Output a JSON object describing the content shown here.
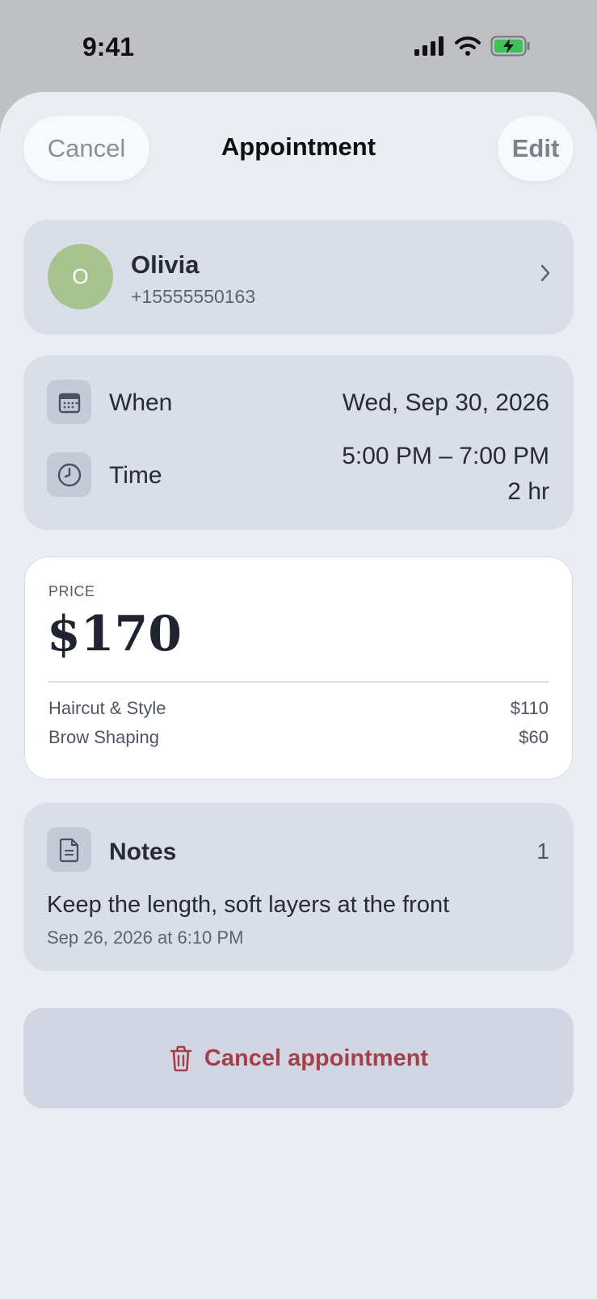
{
  "status_bar": {
    "time": "9:41"
  },
  "header": {
    "cancel_label": "Cancel",
    "title": "Appointment",
    "edit_label": "Edit"
  },
  "client": {
    "avatar_initial": "O",
    "name": "Olivia",
    "phone": "+15555550163",
    "avatar_color": "#a7c48e"
  },
  "schedule": {
    "when_label": "When",
    "when_value": "Wed, Sep 30, 2026",
    "time_label": "Time",
    "time_range": "5:00 PM – 7:00 PM",
    "duration": "2 hr"
  },
  "price": {
    "label": "PRICE",
    "total": "$170",
    "services": [
      {
        "name": "Haircut & Style",
        "price": "$110"
      },
      {
        "name": "Brow Shaping",
        "price": "$60"
      }
    ]
  },
  "notes": {
    "title": "Notes",
    "count": "1",
    "text": "Keep the length, soft layers at the front",
    "timestamp": "Sep 26, 2026 at 6:10 PM"
  },
  "actions": {
    "cancel_appointment_label": "Cancel appointment",
    "danger_color": "#a5404a"
  },
  "icons": [
    "signal-icon",
    "wifi-icon",
    "battery-charging-icon",
    "chevron-right-icon",
    "calendar-icon",
    "clock-icon",
    "document-icon",
    "trash-icon"
  ]
}
